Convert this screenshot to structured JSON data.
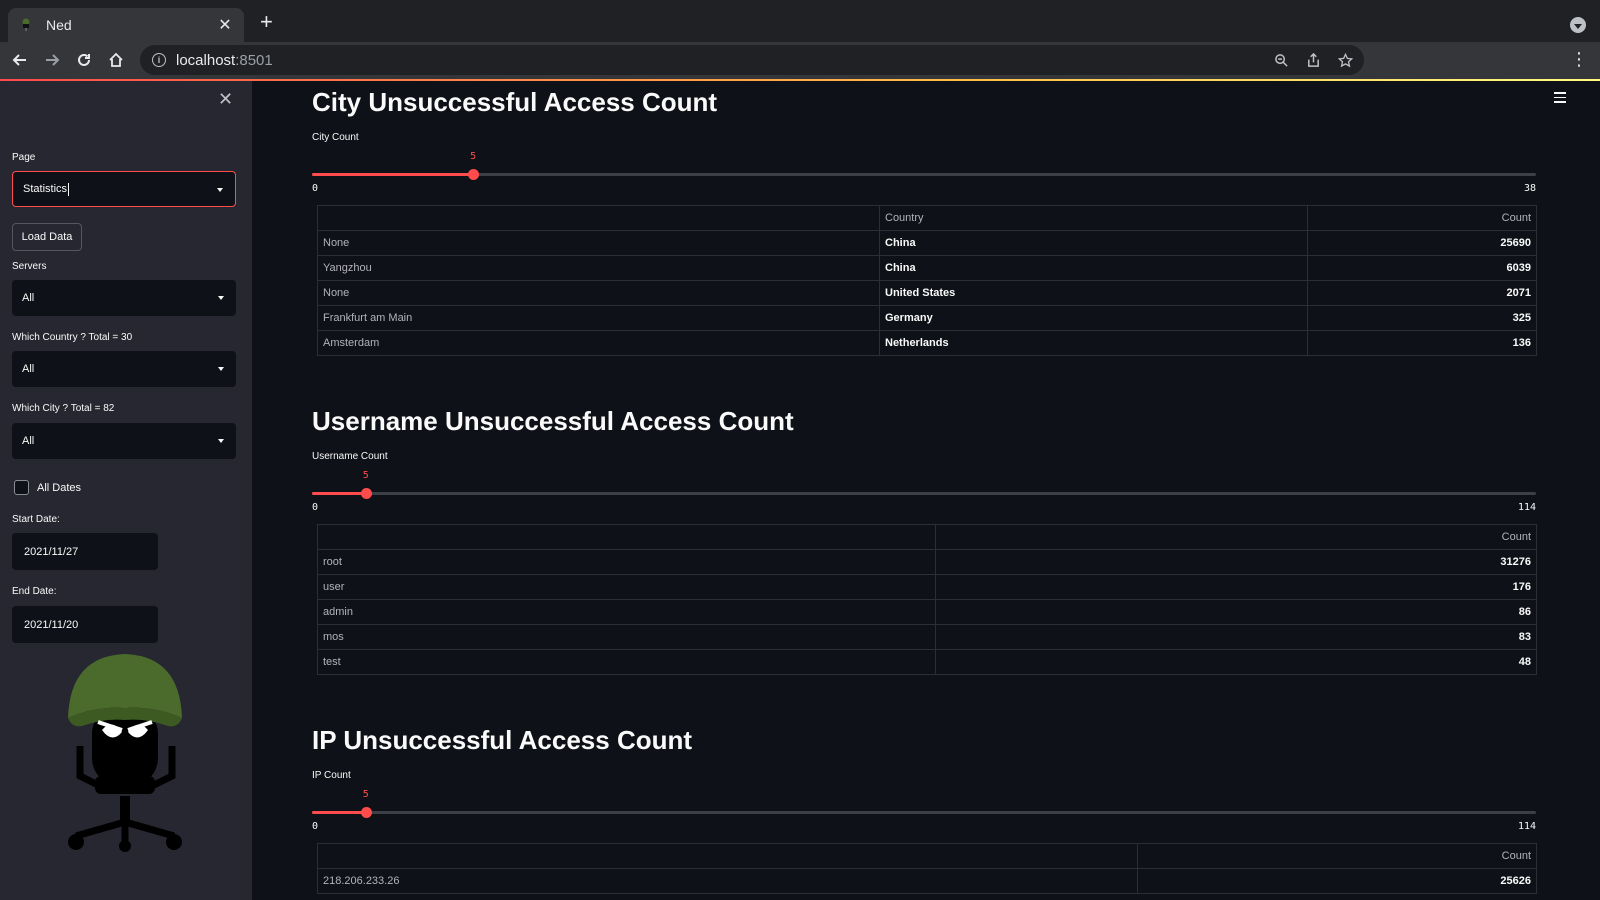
{
  "browser": {
    "tab_title": "Ned",
    "url_host": "localhost",
    "url_port": ":8501"
  },
  "sidebar": {
    "page_label": "Page",
    "page_value": "Statistics",
    "load_button": "Load Data",
    "servers_label": "Servers",
    "servers_value": "All",
    "country_label": "Which Country ? Total = 30",
    "country_value": "All",
    "city_label": "Which City ? Total = 82",
    "city_value": "All",
    "all_dates_label": "All Dates",
    "start_label": "Start Date:",
    "start_value": "2021/11/27",
    "end_label": "End Date:",
    "end_value": "2021/11/20"
  },
  "city": {
    "title": "City Unsuccessful Access Count",
    "slider_label": "City Count",
    "slider_value": "5",
    "slider_min": "0",
    "slider_max": "38",
    "slider_fraction": 0.1316,
    "headers": [
      "",
      "Country",
      "Count"
    ],
    "rows": [
      {
        "idx": "None",
        "country": "China",
        "count": "25690"
      },
      {
        "idx": "Yangzhou",
        "country": "China",
        "count": "6039"
      },
      {
        "idx": "None",
        "country": "United States",
        "count": "2071"
      },
      {
        "idx": "Frankfurt am Main",
        "country": "Germany",
        "count": "325"
      },
      {
        "idx": "Amsterdam",
        "country": "Netherlands",
        "count": "136"
      }
    ]
  },
  "username": {
    "title": "Username Unsuccessful Access Count",
    "slider_label": "Username Count",
    "slider_value": "5",
    "slider_min": "0",
    "slider_max": "114",
    "slider_fraction": 0.0439,
    "headers": [
      "",
      "Count"
    ],
    "rows": [
      {
        "idx": "root",
        "count": "31276"
      },
      {
        "idx": "user",
        "count": "176"
      },
      {
        "idx": "admin",
        "count": "86"
      },
      {
        "idx": "mos",
        "count": "83"
      },
      {
        "idx": "test",
        "count": "48"
      }
    ]
  },
  "ip": {
    "title": "IP Unsuccessful Access Count",
    "slider_label": "IP Count",
    "slider_value": "5",
    "slider_min": "0",
    "slider_max": "114",
    "slider_fraction": 0.0439,
    "headers": [
      "",
      "Count"
    ],
    "rows": [
      {
        "idx": "218.206.233.26",
        "count": "25626"
      }
    ]
  }
}
